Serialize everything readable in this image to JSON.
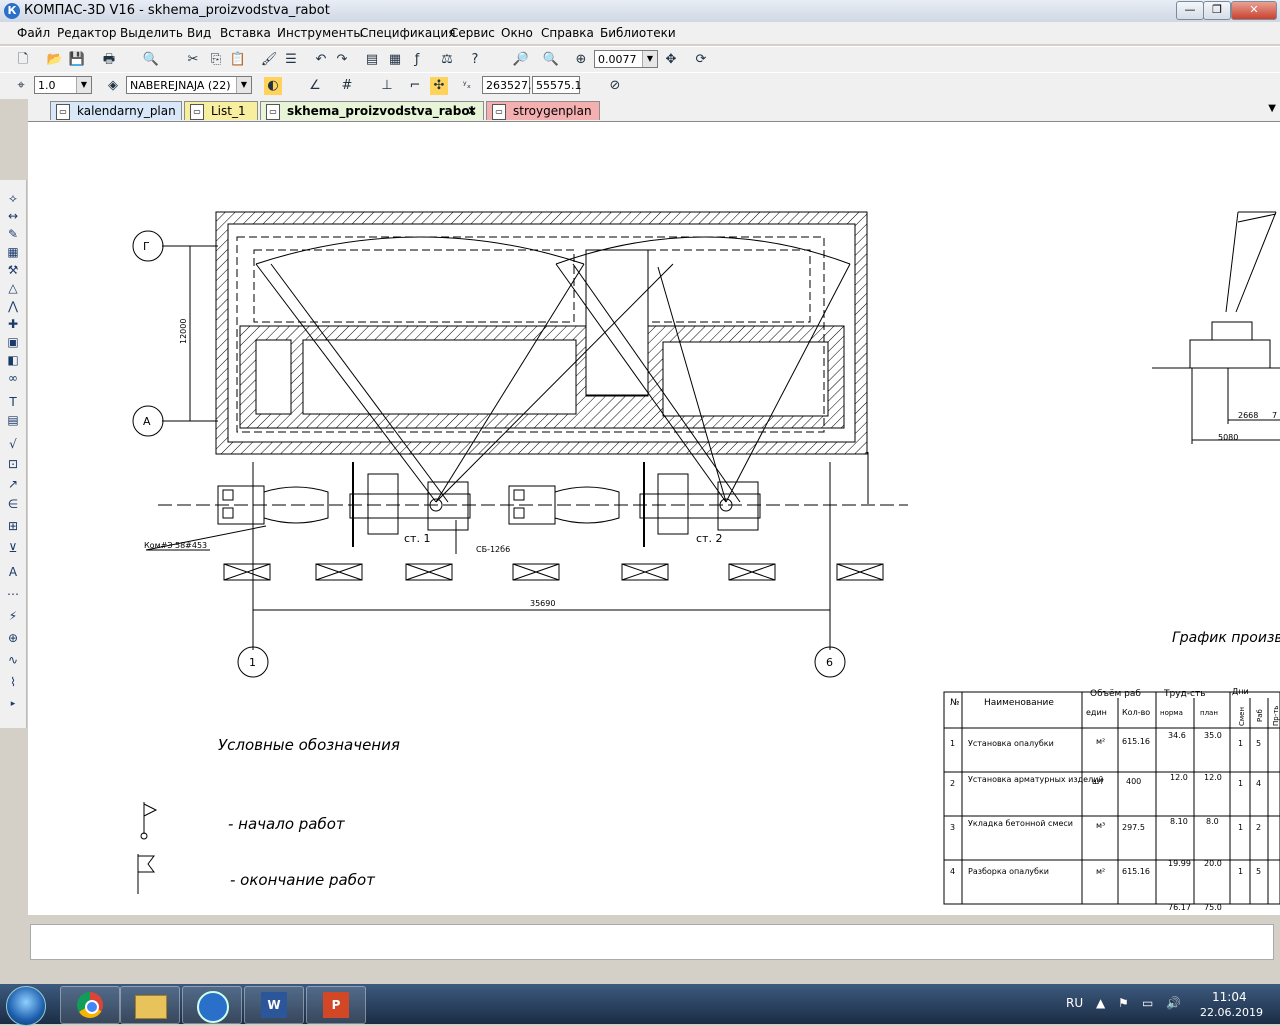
{
  "window": {
    "title": "КОМПАС-3D V16  - skhema_proizvodstva_rabot",
    "app_icon": "К"
  },
  "menu": [
    "Файл",
    "Редактор",
    "Выделить",
    "Вид",
    "Вставка",
    "Инструменты",
    "Спецификация",
    "Сервис",
    "Окно",
    "Справка",
    "Библиотеки"
  ],
  "toolbar1": {
    "zoom": "0.0077"
  },
  "toolbar2": {
    "line_scale": "1.0",
    "layer": "NABEREJNAJA (22)",
    "coord_x": "263527.",
    "coord_y": "55575.1"
  },
  "tabs": [
    {
      "label": "kalendarny_plan",
      "color": "#d8e8f8",
      "active": false
    },
    {
      "label": "List_1",
      "color": "#f8eea0",
      "active": false
    },
    {
      "label": "skhema_proizvodstva_rabot",
      "color": "#e8f4d8",
      "active": true
    },
    {
      "label": "stroygenplan",
      "color": "#f4b0b0",
      "active": false
    }
  ],
  "drawing": {
    "axis_G": "Г",
    "axis_A": "А",
    "axis_1": "1",
    "axis_6": "6",
    "dim_vertical": "12000",
    "dim_horizontal": "35690",
    "label_pump": "Ком#З 58#453",
    "label_st1": "ст. 1",
    "label_st2": "ст. 2",
    "label_cb": "СБ-12б6",
    "elev_dim1": "2668",
    "elev_dim2": "5080",
    "elev_dim3": "7",
    "legend_title": "Условные обозначения",
    "legend_start": "- начало работ",
    "legend_end": "- окончание работ",
    "graph_title": "График производ"
  },
  "table": {
    "headers": {
      "no": "№",
      "name": "Наименование",
      "volume": "Объём раб",
      "unit": "един",
      "qty": "Кол-во",
      "labor": "Труд-сть",
      "norm": "норма",
      "plan": "план",
      "days": "Дни",
      "shifts": "Смен",
      "workers": "Раб",
      "extra": "Пр-ть"
    },
    "rows": [
      {
        "no": "1",
        "name": "Установка опалубки",
        "unit": "м²",
        "qty": "615.16",
        "norm": "34.6",
        "plan": "35.0",
        "shifts": "1",
        "workers": "5"
      },
      {
        "no": "2",
        "name": "Установка арматурных изделий",
        "unit": "шт",
        "qty": "400",
        "norm": "12.0",
        "plan": "12.0",
        "shifts": "1",
        "workers": "4"
      },
      {
        "no": "3",
        "name": "Укладка бетонной смеси",
        "unit": "м³",
        "qty": "297.5",
        "norm": "8.10",
        "plan": "8.0",
        "shifts": "1",
        "workers": "2"
      },
      {
        "no": "4",
        "name": "Разборка опалубки",
        "unit": "м²",
        "qty": "615.16",
        "norm": "19.99",
        "plan": "20.0",
        "shifts": "1",
        "workers": "5"
      }
    ],
    "total_norm": "76.17",
    "total_plan": "75.0"
  },
  "taskbar": {
    "lang": "RU",
    "time": "11:04",
    "date": "22.06.2019"
  }
}
